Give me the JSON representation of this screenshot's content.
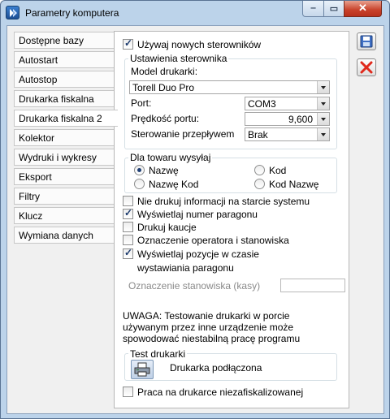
{
  "window": {
    "title": "Parametry komputera"
  },
  "titlebar": {
    "minimize_glyph": "‒",
    "maximize_glyph": "▭",
    "close_glyph": "✕"
  },
  "nav": {
    "items": [
      "Dostępne bazy",
      "Autostart",
      "Autostop",
      "Drukarka fiskalna",
      "Drukarka fiskalna 2",
      "Kolektor",
      "Wydruki i wykresy",
      "Eksport",
      "Filtry",
      "Klucz",
      "Wymiana danych"
    ],
    "active": "Drukarka fiskalna 2"
  },
  "form": {
    "use_new_drivers": {
      "label": "Używaj nowych sterowników",
      "checked": true
    },
    "driver_settings": {
      "title": "Ustawienia sterownika",
      "model_label": "Model drukarki:",
      "model_value": "Torell Duo Pro",
      "port_label": "Port:",
      "port_value": "COM3",
      "speed_label": "Prędkość portu:",
      "speed_value": "9,600",
      "flow_label": "Sterowanie przepływem",
      "flow_value": "Brak"
    },
    "send_for_item": {
      "title": "Dla towaru wysyłaj",
      "options": [
        "Nazwę",
        "Kod",
        "Nazwę Kod",
        "Kod Nazwę"
      ],
      "selected": "Nazwę"
    },
    "checkboxes": {
      "no_print_startup": {
        "label": "Nie drukuj informacji na starcie systemu",
        "checked": false
      },
      "show_receipt_number": {
        "label": "Wyświetlaj numer paragonu",
        "checked": true
      },
      "print_deposits": {
        "label": "Drukuj kaucje",
        "checked": false
      },
      "operator_station": {
        "label": "Oznaczenie operatora i stanowiska",
        "checked": false
      },
      "show_items_line1": {
        "label": "Wyświetlaj pozycje w czasie",
        "checked": true
      },
      "show_items_line2": "wystawiania paragonu"
    },
    "station_label": "Oznaczenie stanowiska (kasy)",
    "station_value": "",
    "warning": [
      "UWAGA: Testowanie drukarki w porcie",
      "używanym przez inne urządzenie może",
      "spowodować niestabilną pracę programu"
    ],
    "test": {
      "title": "Test drukarki",
      "status": "Drukarka podłączona"
    },
    "non_fiscal": {
      "label": "Praca na drukarce niezafiskalizowanej",
      "checked": false
    }
  },
  "actions": {
    "save_icon": "save-icon",
    "cancel_icon": "cancel-icon"
  },
  "colors": {
    "window_frame": "#bcd3ea",
    "close_button": "#c8412a",
    "cancel_red": "#e0281b"
  }
}
